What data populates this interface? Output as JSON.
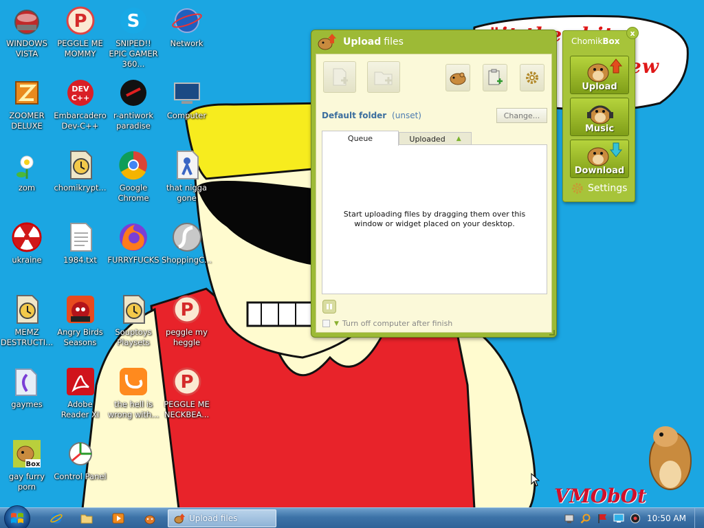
{
  "wallpaper": {
    "caption_line1": "\"it the       shit",
    "caption_line2": "ew",
    "signature": "VMObOt"
  },
  "desktop_icons": [
    {
      "label": "WINDOWS VISTA",
      "icon": "windows-vista-orb-icon"
    },
    {
      "label": "PEGGLE ME MOMMY",
      "icon": "peggle-icon"
    },
    {
      "label": "SNIPED!! EPIC GAMER 360...",
      "icon": "skype-icon"
    },
    {
      "label": "Network",
      "icon": "network-globe-icon"
    },
    {
      "label": "ZOOMER DELUXE",
      "icon": "zuma-icon"
    },
    {
      "label": "Embarcadero Dev-C++",
      "icon": "devcpp-icon"
    },
    {
      "label": "r-antiwork paradise",
      "icon": "r-antiwork-icon"
    },
    {
      "label": "Computer",
      "icon": "computer-icon"
    },
    {
      "label": "zom",
      "icon": "plant-icon"
    },
    {
      "label": "chomikrypt...",
      "icon": "hourglass-file-icon"
    },
    {
      "label": "Google Chrome",
      "icon": "chrome-icon"
    },
    {
      "label": "that nigga gone",
      "icon": "disappearing-person-icon"
    },
    {
      "label": "ukraine",
      "icon": "radiation-icon"
    },
    {
      "label": "1984.txt",
      "icon": "text-file-icon"
    },
    {
      "label": "FURRYFUCKS",
      "icon": "firefox-icon"
    },
    {
      "label": "ShoppingC...",
      "icon": "flash-icon"
    },
    {
      "label": "MEMZ DESTRUCTI...",
      "icon": "hourglass-file-icon"
    },
    {
      "label": "Angry Birds Seasons",
      "icon": "angry-birds-icon"
    },
    {
      "label": "Souptoys Playsets",
      "icon": "hourglass-file-icon"
    },
    {
      "label": "peggle my heggle",
      "icon": "peggle-icon"
    },
    {
      "label": "gaymes",
      "icon": "games-folder-icon"
    },
    {
      "label": "Adobe Reader XI",
      "icon": "adobe-reader-icon"
    },
    {
      "label": "the hell is wrong with...",
      "icon": "uc-browser-icon"
    },
    {
      "label": "PEGGLE ME NECKBEA...",
      "icon": "peggle-icon"
    },
    {
      "label": "gay furry porn",
      "icon": "chomikbox-icon"
    },
    {
      "label": "Control Panel",
      "icon": "control-panel-icon"
    }
  ],
  "upload_window": {
    "title_bold": "Upload",
    "title_rest": "files",
    "default_folder_label": "Default folder",
    "default_folder_value": "(unset)",
    "change_button": "Change...",
    "tabs": [
      "Queue",
      "Uploaded"
    ],
    "empty_message": "Start uploading files by dragging them over this window or widget placed on your desktop.",
    "shutdown_label": "Turn off computer after finish"
  },
  "chomikbox": {
    "title_regular": "Chomik",
    "title_bold": "Box",
    "close": "x",
    "buttons": [
      "Upload",
      "Music",
      "Download"
    ],
    "settings": "Settings"
  },
  "taskbar": {
    "active_task": "Upload files",
    "clock": "10:50 AM"
  },
  "colors": {
    "desktop_bg": "#1ba6e2",
    "chomik_green": "#9dba36",
    "window_body": "#fbf9d9",
    "taskbar": "#3d73a8"
  }
}
